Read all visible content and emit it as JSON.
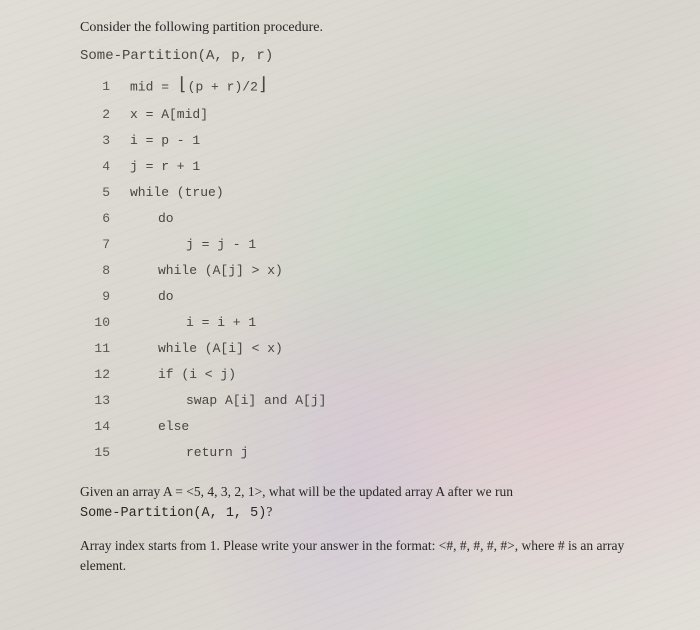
{
  "intro": "Consider the following partition procedure.",
  "procedure": "Some-Partition(A, p, r)",
  "lines": {
    "l1_num": "1",
    "l1_prefix": "mid = ",
    "l1_expr": "(p + r)/2",
    "l2_num": "2",
    "l2_code": "x = A[mid]",
    "l3_num": "3",
    "l3_code": "i = p - 1",
    "l4_num": "4",
    "l4_code": "j = r + 1",
    "l5_num": "5",
    "l5_code": "while (true)",
    "l6_num": "6",
    "l6_code": "do",
    "l7_num": "7",
    "l7_code": "j = j - 1",
    "l8_num": "8",
    "l8_code": "while (A[j] > x)",
    "l9_num": "9",
    "l9_code": "do",
    "l10_num": "10",
    "l10_code": "i = i + 1",
    "l11_num": "11",
    "l11_code": "while (A[i] < x)",
    "l12_num": "12",
    "l12_code": "if (i < j)",
    "l13_num": "13",
    "l13_code": "swap A[i] and A[j]",
    "l14_num": "14",
    "l14_code": "else",
    "l15_num": "15",
    "l15_code": "return j"
  },
  "question": {
    "part1": "Given an array A = <5, 4, 3, 2, 1>, what will be the updated array A after we run ",
    "call": "Some-Partition(A, 1, 5)",
    "part2": "?"
  },
  "format_note": "Array index starts from 1. Please write your answer in the format: <#, #, #, #, #>, where # is an array element."
}
